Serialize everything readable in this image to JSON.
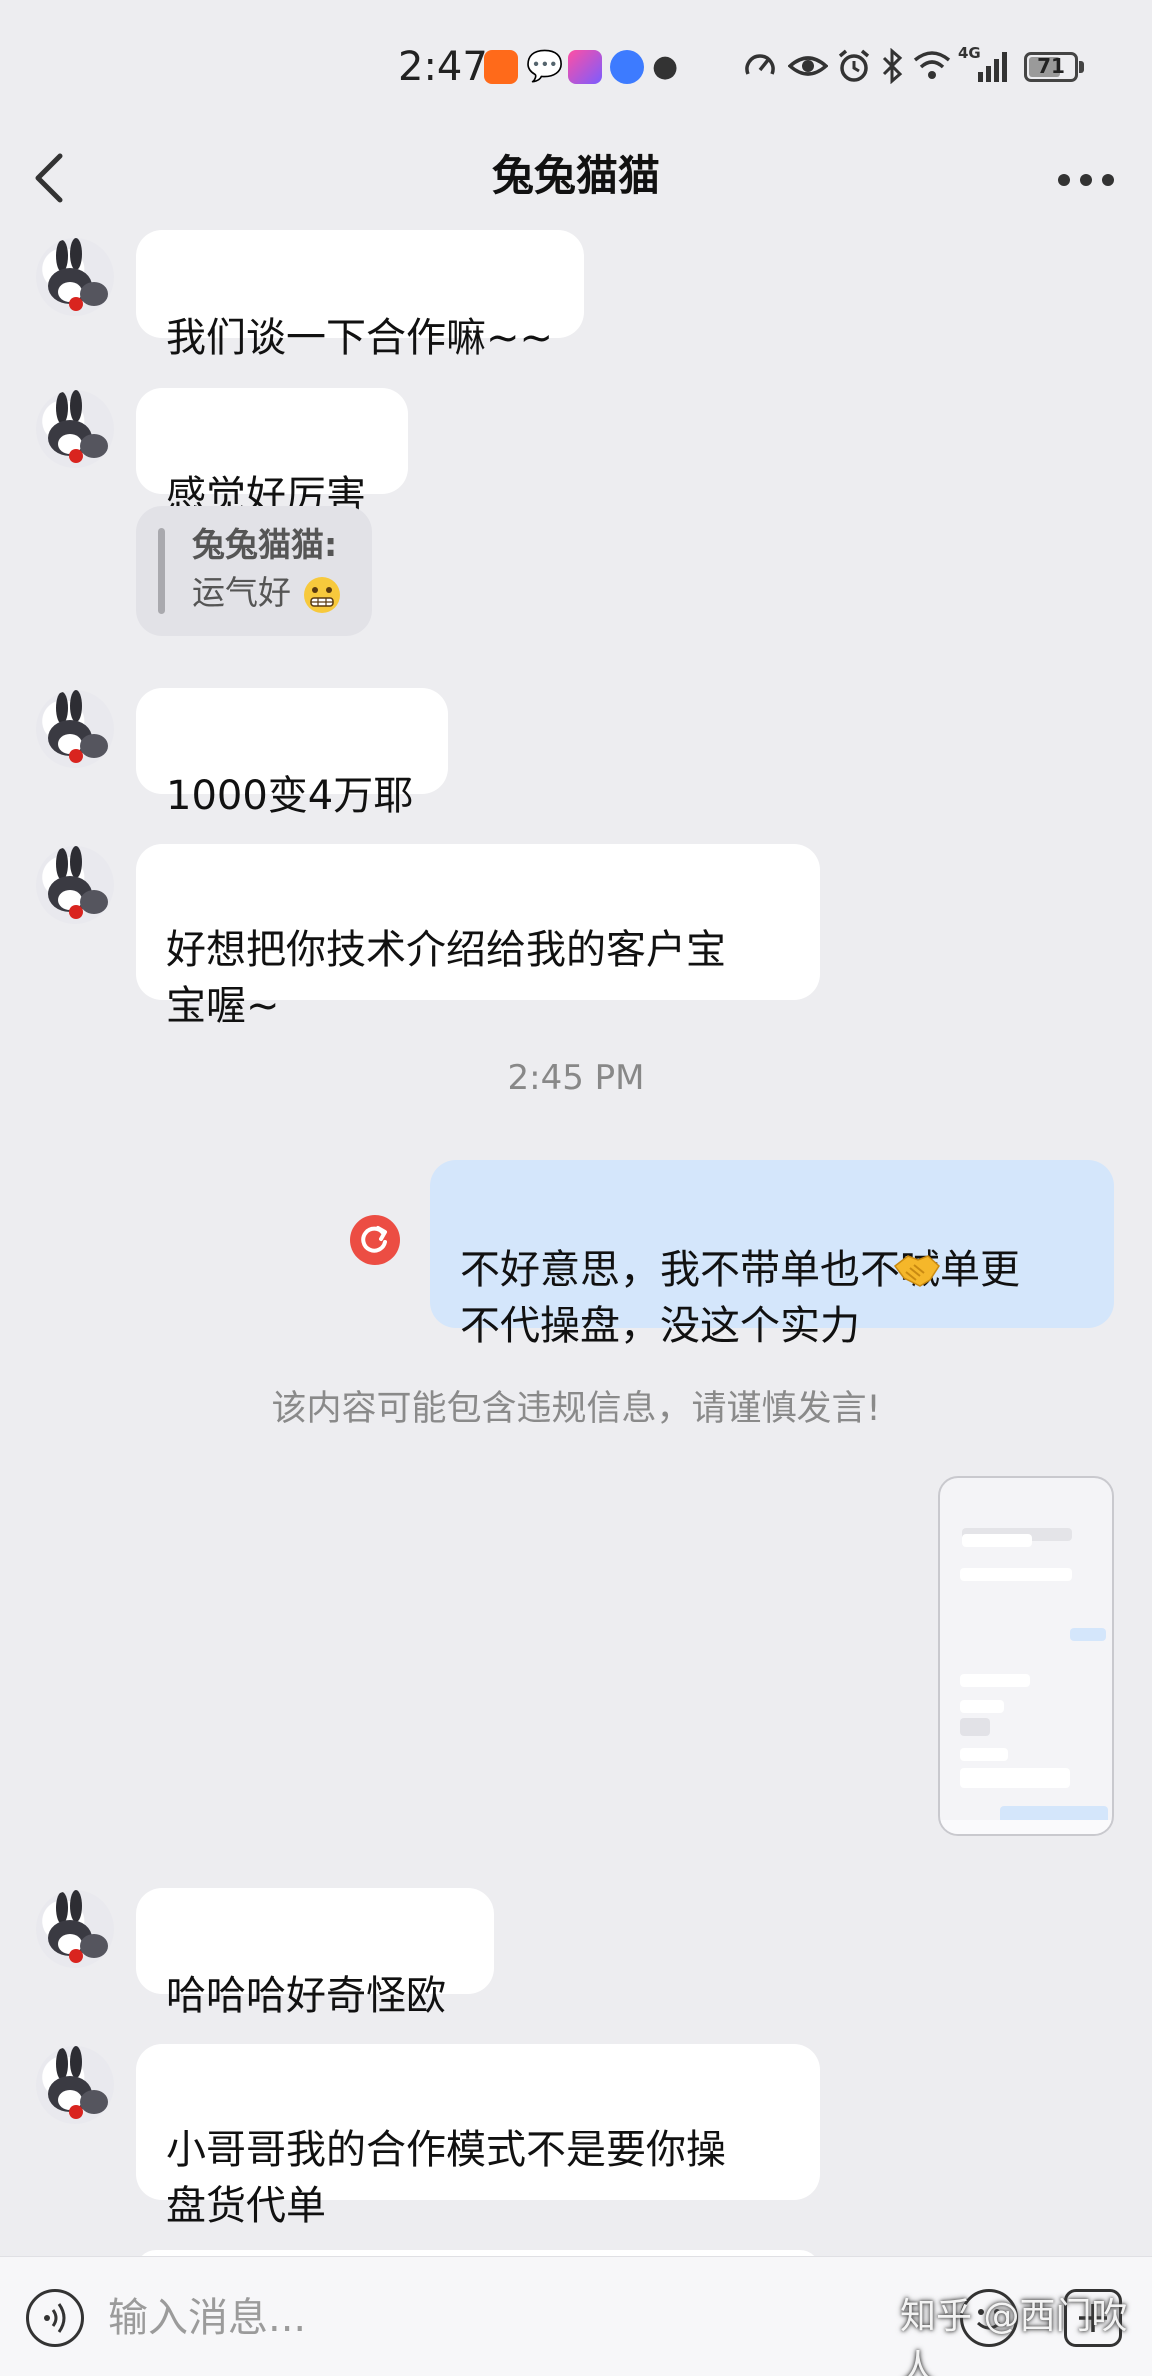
{
  "status_bar": {
    "time": "2:47",
    "battery": "71",
    "battery_level": 0.71,
    "icons": [
      "taobao-11-11-icon",
      "message-icon",
      "app-icon",
      "music-icon",
      "qq-icon",
      "speed-icon",
      "eye-icon",
      "alarm-icon",
      "bluetooth-icon",
      "wifi-icon",
      "signal-4g-icon",
      "battery-icon"
    ],
    "network": "4G"
  },
  "header": {
    "title": "兔兔猫猫"
  },
  "messages": [
    {
      "text": "我们谈一下合作嘛~~"
    },
    {
      "text": "感觉好厉害"
    },
    {
      "quote_name": "兔兔猫猫:",
      "quote_text": "运气好"
    },
    {
      "text": "1000变4万耶"
    },
    {
      "text": "好想把你技术介绍给我的客户宝\n宝喔~"
    },
    {
      "time": "2:45 PM"
    },
    {
      "text": "不好意思，我不带单也不喊单更\n不代操盘，没这个实力"
    },
    {
      "notice": "该内容可能包含违规信息，请谨慎发言!"
    },
    {
      "text": "哈哈哈好奇怪欧"
    },
    {
      "text": "小哥哥我的合作模式不是要你操\n盘货代单"
    }
  ],
  "input_bar": {
    "placeholder": "输入消息..."
  },
  "watermark": "知乎 @西门吹人",
  "colors": {
    "background": "#ededf0",
    "incoming_bubble": "#ffffff",
    "outgoing_bubble": "#d4e6fb",
    "error": "#ec4d43"
  }
}
